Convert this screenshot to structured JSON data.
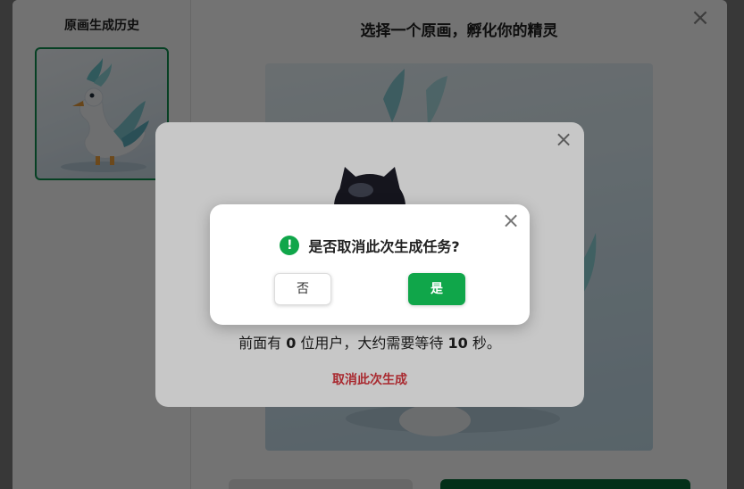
{
  "sidebar": {
    "title": "原画生成历史"
  },
  "main": {
    "title": "选择一个原画，孵化你的精灵",
    "close_icon": "×"
  },
  "progress": {
    "close_icon": "×",
    "queue_prefix": "前面有 ",
    "queue_count": "0",
    "queue_middle": " 位用户，大约需要等待 ",
    "queue_seconds": "10",
    "queue_suffix": " 秒。",
    "cancel_label": "取消此次生成"
  },
  "confirm": {
    "close_icon": "×",
    "alert_icon": "!",
    "message": "是否取消此次生成任务?",
    "no_label": "否",
    "yes_label": "是"
  },
  "colors": {
    "accent": "#10a64a",
    "cancel": "#d9363e",
    "history_border": "#0f8f4f"
  }
}
